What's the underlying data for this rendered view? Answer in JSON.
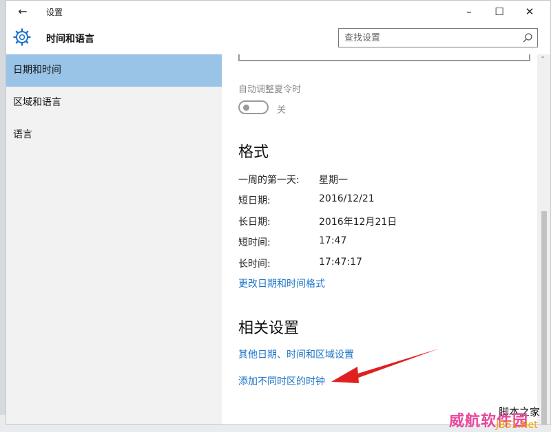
{
  "window": {
    "back_icon": "←",
    "title": "设置",
    "minimize_icon": "–",
    "maximize_icon": "☐",
    "close_icon": "✕"
  },
  "header": {
    "section_title": "时间和语言",
    "search_placeholder": "查找设置"
  },
  "sidebar": {
    "items": [
      {
        "label": "日期和时间",
        "active": true
      },
      {
        "label": "区域和语言",
        "active": false
      },
      {
        "label": "语言",
        "active": false
      }
    ]
  },
  "content": {
    "dst_label": "自动调整夏令时",
    "dst_toggle_state": "关",
    "format_heading": "格式",
    "formats": [
      {
        "label": "一周的第一天:",
        "value": "星期一"
      },
      {
        "label": "短日期:",
        "value": "2016/12/21"
      },
      {
        "label": "长日期:",
        "value": "2016年12月21日"
      },
      {
        "label": "短时间:",
        "value": "17:47"
      },
      {
        "label": "长时间:",
        "value": "17:47:17"
      }
    ],
    "change_format_link": "更改日期和时间格式",
    "related_heading": "相关设置",
    "related_links": [
      "其他日期、时间和区域设置",
      "添加不同时区的时钟"
    ]
  },
  "colors": {
    "accent": "#1a73c8",
    "active_nav": "#99c4e8",
    "annotation_arrow": "#e02020"
  },
  "watermark": {
    "top": "脚本之家",
    "main": "威航软件园",
    "sub": "JB51.Net"
  }
}
